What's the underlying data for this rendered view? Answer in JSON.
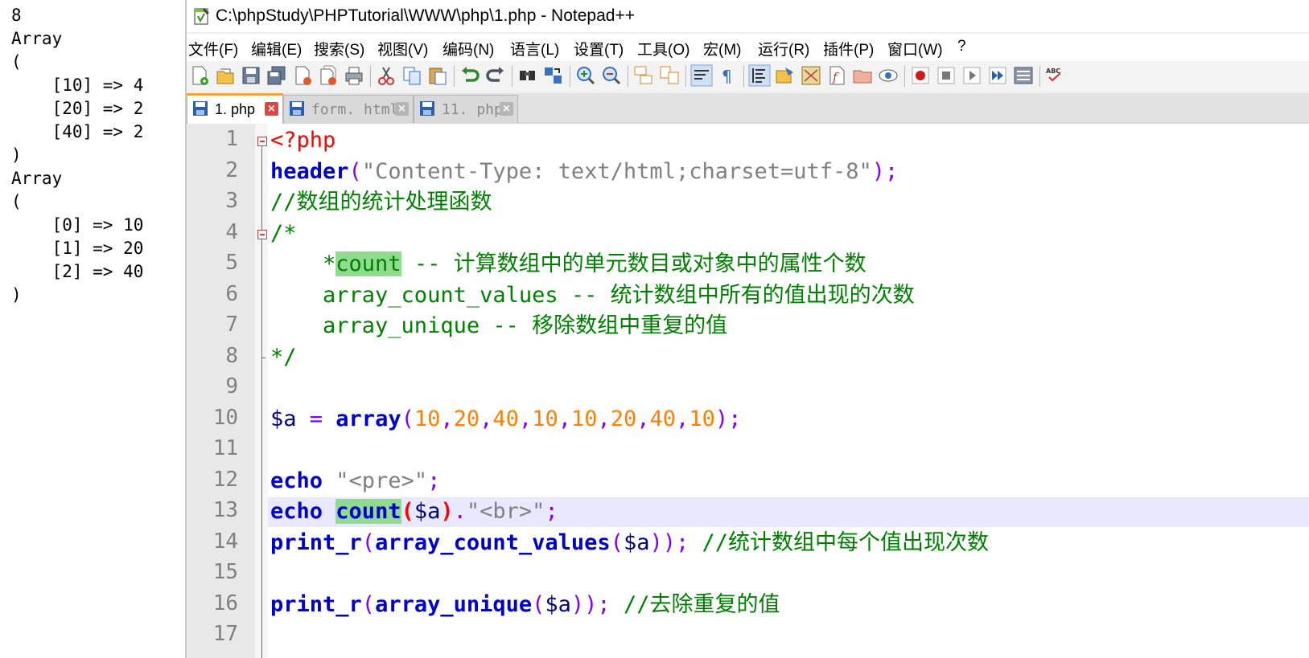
{
  "output": {
    "lines": [
      "8",
      "Array",
      "(",
      "    [10] => 4",
      "    [20] => 2",
      "    [40] => 2",
      ")",
      "Array",
      "(",
      "    [0] => 10",
      "    [1] => 20",
      "    [2] => 40",
      ")"
    ]
  },
  "window": {
    "title": "C:\\phpStudy\\PHPTutorial\\WWW\\php\\1.php - Notepad++",
    "icon": "notepad-plus-plus-icon"
  },
  "menu": [
    "文件(F)",
    "编辑(E)",
    "搜索(S)",
    "视图(V)",
    "编码(N)",
    "语言(L)",
    "设置(T)",
    "工具(O)",
    "宏(M)",
    "运行(R)",
    "插件(P)",
    "窗口(W)",
    "?"
  ],
  "toolbar": {
    "icons": [
      "new-file-icon",
      "open-file-icon",
      "save-icon",
      "save-all-icon",
      "close-icon",
      "close-all-icon",
      "print-icon",
      "cut-icon",
      "copy-icon",
      "paste-icon",
      "undo-icon",
      "redo-icon",
      "find-icon",
      "replace-icon",
      "zoom-in-icon",
      "zoom-out-icon",
      "sync-vertical-icon",
      "sync-horizontal-icon",
      "word-wrap-icon",
      "show-all-chars-icon",
      "indent-guide-icon",
      "user-lang-icon",
      "doc-map-icon",
      "function-list-icon",
      "folder-workspace-icon",
      "monitoring-icon",
      "record-macro-icon",
      "stop-record-icon",
      "play-macro-icon",
      "run-macro-multiple-icon",
      "save-macro-icon",
      "spell-check-icon"
    ]
  },
  "tabs": [
    {
      "label": "1. php",
      "active": true
    },
    {
      "label": "form. html",
      "active": false
    },
    {
      "label": "11. php",
      "active": false
    }
  ],
  "editor": {
    "line_numbers": [
      "1",
      "2",
      "3",
      "4",
      "5",
      "6",
      "7",
      "8",
      "9",
      "10",
      "11",
      "12",
      "13",
      "14",
      "15",
      "16",
      "17"
    ],
    "current_line": "13",
    "lines": {
      "l1_php": "<?php",
      "l2_header": "header",
      "l2_open": "(",
      "l2_str": "\"Content-Type: text/html;charset=utf-8\"",
      "l2_close": ");",
      "l3": "//数组的统计处理函数",
      "l4": "/*",
      "l5_star": "    *",
      "l5_count": "count",
      "l5_rest": " -- 计算数组中的单元数目或对象中的属性个数",
      "l6": "    array_count_values -- 统计数组中所有的值出现的次数",
      "l7": "    array_unique -- 移除数组中重复的值",
      "l8": "*/",
      "l10_var": "$a",
      "l10_eq": " = ",
      "l10_kw": "array",
      "l10_open": "(",
      "l10_nums": [
        "10",
        "20",
        "40",
        "10",
        "10",
        "20",
        "40",
        "10"
      ],
      "l10_comma": ",",
      "l10_close": ");",
      "l12_echo": "echo",
      "l12_str": " \"<pre>\"",
      "l12_semi": ";",
      "l13_echo": "echo",
      "l13_count": "count",
      "l13_open": "(",
      "l13_var": "$a",
      "l13_close": ")",
      "l13_dot": ".",
      "l13_str": "\"<br>\"",
      "l13_semi": ";",
      "l14_kw": "print_r",
      "l14_open": "(",
      "l14_fn": "array_count_values",
      "l14_open2": "(",
      "l14_var": "$a",
      "l14_close": "));",
      "l14_cmt": " //统计数组中每个值出现次数",
      "l16_kw": "print_r",
      "l16_open": "(",
      "l16_fn": "array_unique",
      "l16_open2": "(",
      "l16_var": "$a",
      "l16_close": "));",
      "l16_cmt": " //去除重复的值"
    }
  }
}
